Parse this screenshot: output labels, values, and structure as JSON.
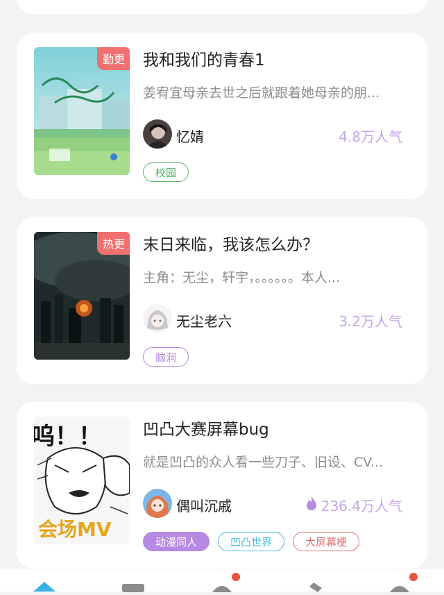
{
  "books": [
    {
      "badge": "勤更",
      "title": "我和我们的青春1",
      "summary": "姜宥宜母亲去世之后就跟着她母亲的朋...",
      "author": "忆婧",
      "popularity": "4.8万人气",
      "hot_icon": false,
      "tags": [
        {
          "label": "校园",
          "color": "#5bb26a"
        }
      ]
    },
    {
      "badge": "热更",
      "title": "末日来临，我该怎么办？",
      "summary": "主角：无尘，轩宇，。。。。。。本人...",
      "author": "无尘老六",
      "popularity": "3.2万人气",
      "hot_icon": false,
      "tags": [
        {
          "label": "脑洞",
          "color": "#b68ae0"
        }
      ]
    },
    {
      "badge": "",
      "title": "凹凸大赛屏幕bug",
      "summary": "就是凹凸的众人看一些刀子、旧设、CV...",
      "author": "偶叫沉戚",
      "popularity": "236.4万人气",
      "hot_icon": true,
      "tags": [
        {
          "label": "动漫同人",
          "color": "#ffffff",
          "fill": "#b68ae0"
        },
        {
          "label": "凹凸世界",
          "color": "#48b9d6"
        },
        {
          "label": "大屏幕梗",
          "color": "#e56f6f"
        }
      ]
    }
  ],
  "tabbar": {
    "items": [
      "home-icon",
      "library-icon",
      "discover-icon",
      "write-icon",
      "profile-icon"
    ],
    "active_color": "#39b3e6",
    "badge_color": "#e9533d"
  }
}
